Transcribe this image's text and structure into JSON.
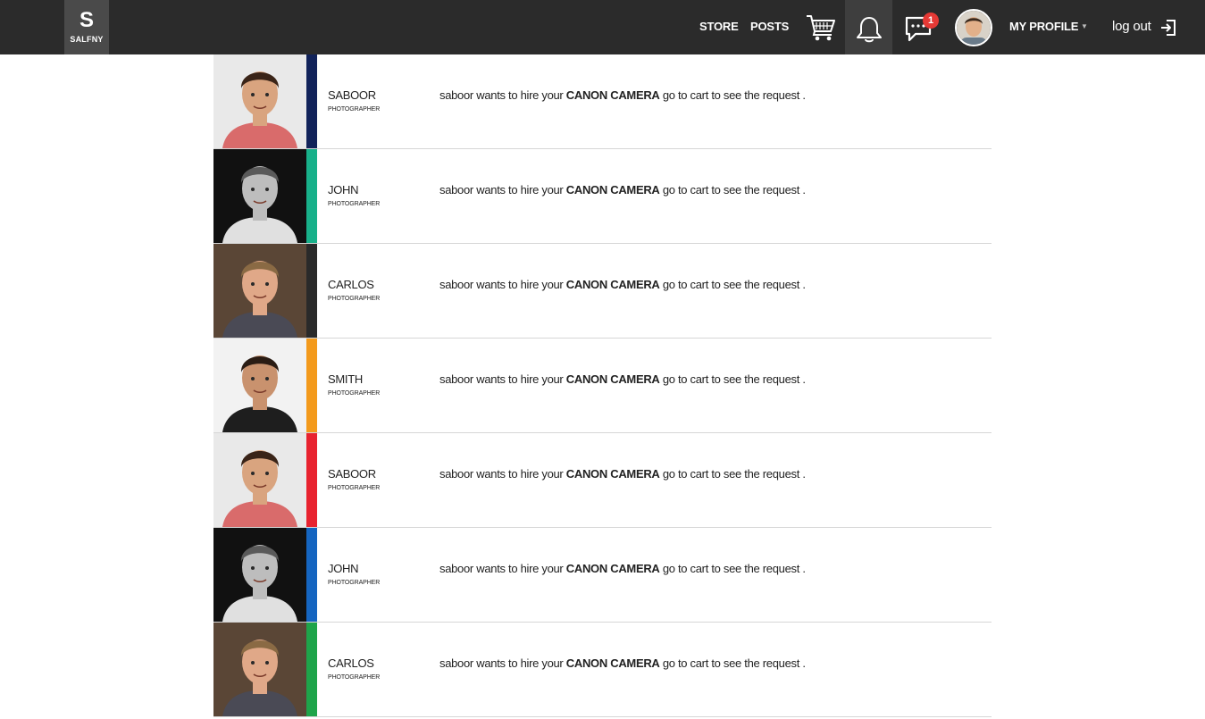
{
  "header": {
    "logo_letter": "S",
    "logo_word": "SALFNY",
    "nav_store": "STORE",
    "nav_posts": "POSTS",
    "chat_badge_count": "1",
    "profile_label": "MY PROFILE",
    "profile_caret": "▼",
    "logout_label": "log out",
    "icons": [
      "cart-icon",
      "bell-icon",
      "chat-icon",
      "logout-icon"
    ]
  },
  "notifications": [
    {
      "name": "SABOOR",
      "role": "PHOTOGRAPHER",
      "msg_pre": "saboor wants to hire your",
      "item": "CANON CAMERA",
      "msg_post": "go to cart to see the request .",
      "stripe_color": "#12235a",
      "bg": "#e9e9e9",
      "skin": "#d9a47f",
      "hair": "#3a2418",
      "shirt": "#d96b6b"
    },
    {
      "name": "JOHN",
      "role": "PHOTOGRAPHER",
      "msg_pre": "saboor wants to hire your",
      "item": "CANON CAMERA",
      "msg_post": "go to cart to see the request .",
      "stripe_color": "#18b08a",
      "bg": "#111111",
      "skin": "#bdbdbd",
      "hair": "#5a5a5a",
      "shirt": "#e0e0e0"
    },
    {
      "name": "CARLOS",
      "role": "PHOTOGRAPHER",
      "msg_pre": "saboor wants to hire your",
      "item": "CANON CAMERA",
      "msg_post": "go to cart to see the request .",
      "stripe_color": "#2a2a2a",
      "bg": "#5a4636",
      "skin": "#e0a888",
      "hair": "#8a6a44",
      "shirt": "#4a4a55"
    },
    {
      "name": "SMITH",
      "role": "PHOTOGRAPHER",
      "msg_pre": "saboor wants to hire your",
      "item": "CANON CAMERA",
      "msg_post": "go to cart to see the request .",
      "stripe_color": "#f39a1c",
      "bg": "#f2f2f2",
      "skin": "#c9926e",
      "hair": "#2a1c14",
      "shirt": "#1e1e1e"
    },
    {
      "name": "SABOOR",
      "role": "PHOTOGRAPHER",
      "msg_pre": "saboor wants to hire your",
      "item": "CANON CAMERA",
      "msg_post": "go to cart to see the request .",
      "stripe_color": "#e8232f",
      "bg": "#e9e9e9",
      "skin": "#d9a47f",
      "hair": "#3a2418",
      "shirt": "#d96b6b"
    },
    {
      "name": "JOHN",
      "role": "PHOTOGRAPHER",
      "msg_pre": "saboor wants to hire your",
      "item": "CANON CAMERA",
      "msg_post": "go to cart to see the request .",
      "stripe_color": "#1565c0",
      "bg": "#111111",
      "skin": "#bdbdbd",
      "hair": "#5a5a5a",
      "shirt": "#e0e0e0"
    },
    {
      "name": "CARLOS",
      "role": "PHOTOGRAPHER",
      "msg_pre": "saboor wants to hire your",
      "item": "CANON CAMERA",
      "msg_post": "go to cart to see the request .",
      "stripe_color": "#1fa44a",
      "bg": "#5a4636",
      "skin": "#e0a888",
      "hair": "#8a6a44",
      "shirt": "#4a4a55"
    }
  ]
}
